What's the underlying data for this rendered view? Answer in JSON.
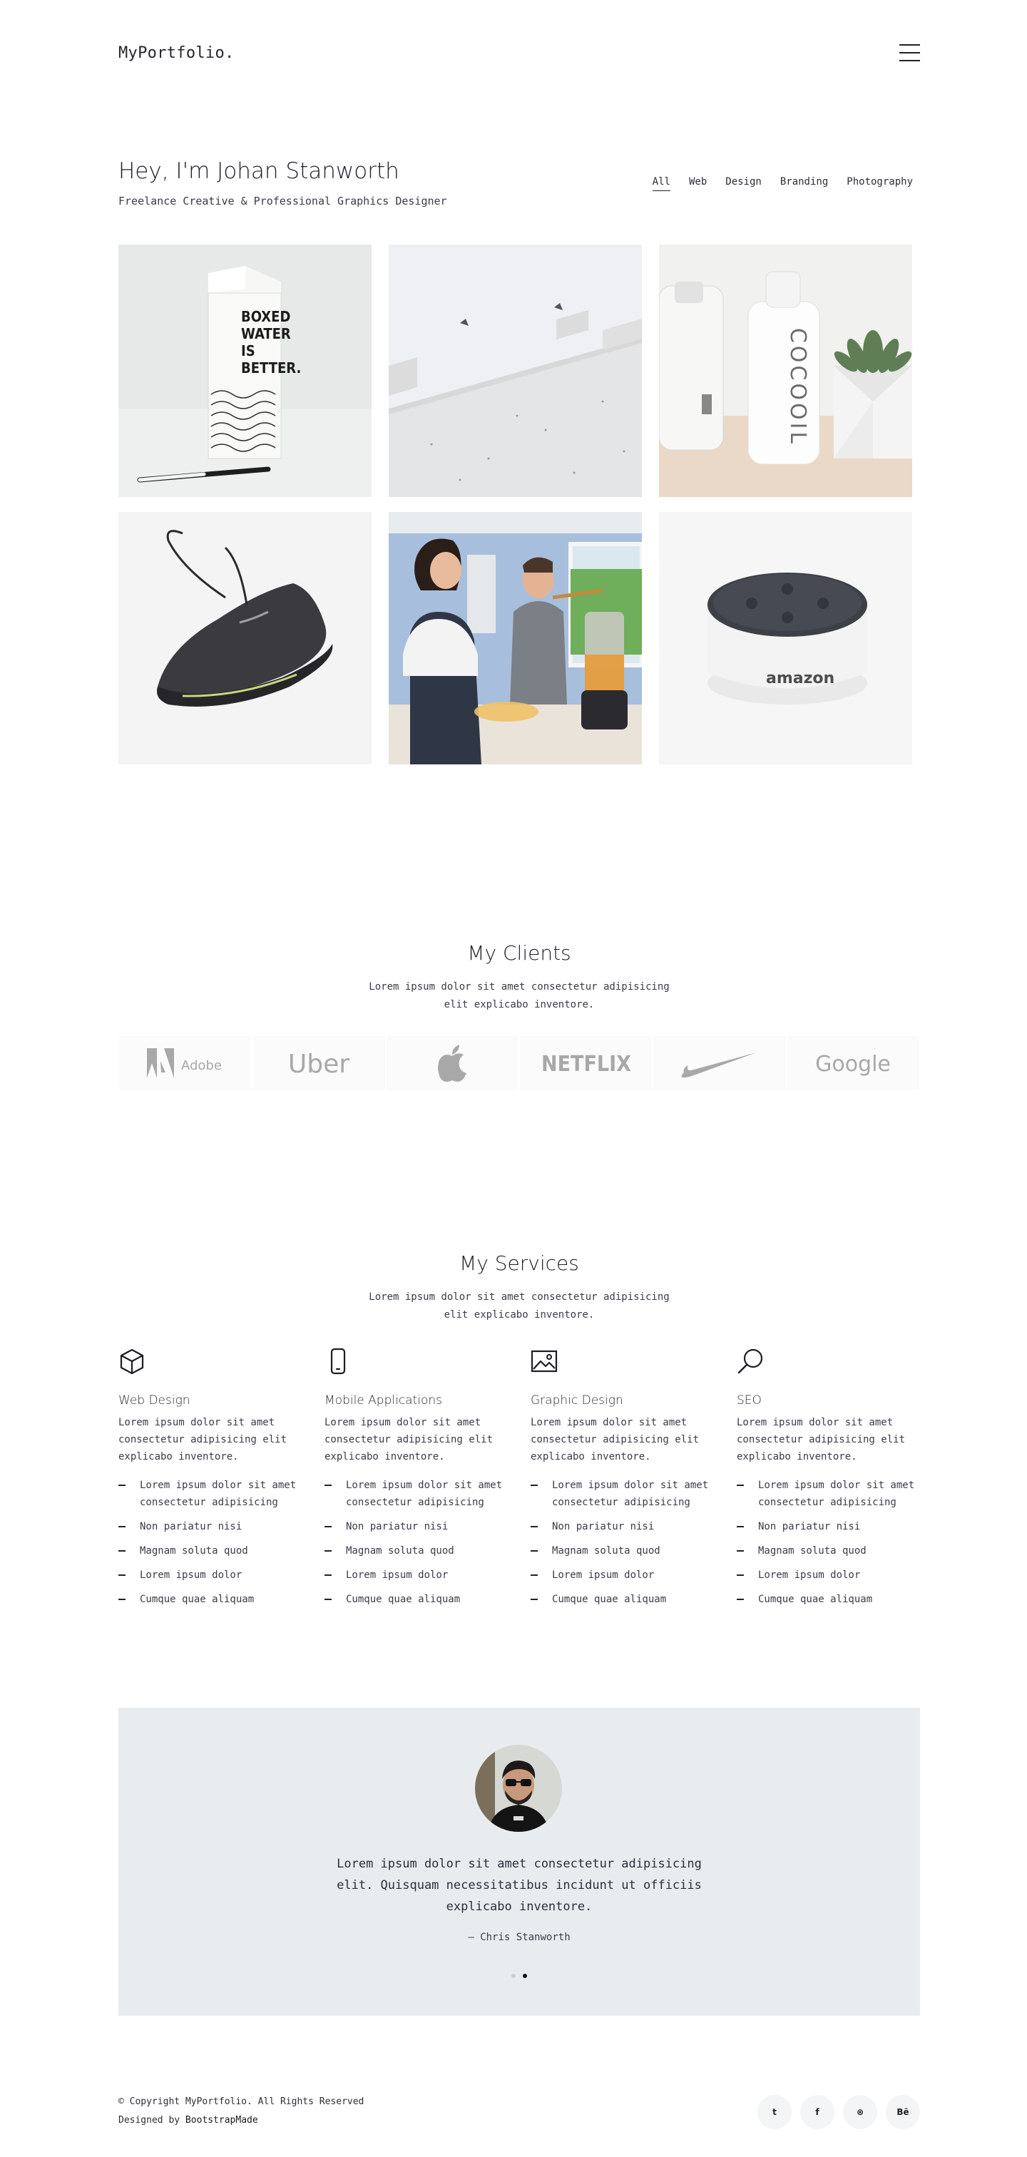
{
  "header": {
    "logo": "MyPortfolio.",
    "menu_icon": "hamburger-menu-icon"
  },
  "intro": {
    "title": "Hey, I'm Johan Stanworth",
    "subtitle": "Freelance Creative & Professional Graphics Designer",
    "filters": [
      "All",
      "Web",
      "Design",
      "Branding",
      "Photography"
    ],
    "active_filter": "All"
  },
  "portfolio": {
    "items": [
      {
        "subject": "boxed-water-carton",
        "text_lines": [
          "BOXED",
          "WATER",
          "IS",
          "BETTER."
        ]
      },
      {
        "subject": "marble-stairs"
      },
      {
        "subject": "cocooil-bottle",
        "brand": "COCOOIL"
      },
      {
        "subject": "sneaker"
      },
      {
        "subject": "kitchen-blender-family"
      },
      {
        "subject": "amazon-echo-dot",
        "brand": "amazon"
      }
    ]
  },
  "clients": {
    "title": "My Clients",
    "subtitle": "Lorem ipsum dolor sit amet consectetur adipisicing elit explicabo inventore.",
    "logos": [
      {
        "name": "Adobe",
        "icon": "adobe-logo"
      },
      {
        "name": "Uber",
        "icon": "uber-logo"
      },
      {
        "name": "",
        "icon": "apple-logo"
      },
      {
        "name": "NETFLIX",
        "icon": "netflix-logo"
      },
      {
        "name": "",
        "icon": "nike-logo"
      },
      {
        "name": "Google",
        "icon": "google-logo"
      }
    ]
  },
  "services": {
    "title": "My Services",
    "subtitle": "Lorem ipsum dolor sit amet consectetur adipisicing elit explicabo inventore.",
    "items": [
      {
        "icon": "cube-icon",
        "title": "Web Design",
        "desc": "Lorem ipsum dolor sit amet consectetur adipisicing elit explicabo inventore.",
        "list": [
          "Lorem ipsum dolor sit amet consectetur adipisicing",
          "Non pariatur nisi",
          "Magnam soluta quod",
          "Lorem ipsum dolor",
          "Cumque quae aliquam"
        ]
      },
      {
        "icon": "phone-icon",
        "title": "Mobile Applications",
        "desc": "Lorem ipsum dolor sit amet consectetur adipisicing elit explicabo inventore.",
        "list": [
          "Lorem ipsum dolor sit amet consectetur adipisicing",
          "Non pariatur nisi",
          "Magnam soluta quod",
          "Lorem ipsum dolor",
          "Cumque quae aliquam"
        ]
      },
      {
        "icon": "image-icon",
        "title": "Graphic Design",
        "desc": "Lorem ipsum dolor sit amet consectetur adipisicing elit explicabo inventore.",
        "list": [
          "Lorem ipsum dolor sit amet consectetur adipisicing",
          "Non pariatur nisi",
          "Magnam soluta quod",
          "Lorem ipsum dolor",
          "Cumque quae aliquam"
        ]
      },
      {
        "icon": "search-icon",
        "title": "SEO",
        "desc": "Lorem ipsum dolor sit amet consectetur adipisicing elit explicabo inventore.",
        "list": [
          "Lorem ipsum dolor sit amet consectetur adipisicing",
          "Non pariatur nisi",
          "Magnam soluta quod",
          "Lorem ipsum dolor",
          "Cumque quae aliquam"
        ]
      }
    ]
  },
  "testimonial": {
    "quote": "Lorem ipsum dolor sit amet consectetur adipisicing elit. Quisquam necessitatibus incidunt ut officiis explicabo inventore.",
    "author": "— Chris Stanworth",
    "slides": 2,
    "active_slide": 2
  },
  "footer": {
    "copyright": "© Copyright MyPortfolio. All Rights Reserved",
    "credit_prefix": "Designed by ",
    "credit_link": "BootstrapMade",
    "socials": [
      {
        "icon": "twitter-icon",
        "glyph": "t"
      },
      {
        "icon": "facebook-icon",
        "glyph": "f"
      },
      {
        "icon": "dribbble-icon",
        "glyph": "⊛"
      },
      {
        "icon": "behance-icon",
        "glyph": "Bē"
      }
    ]
  },
  "colors": {
    "text": "#2b2b3a",
    "testimonial_bg": "#e9ecef",
    "logo_gray": "#a8a8a8"
  }
}
